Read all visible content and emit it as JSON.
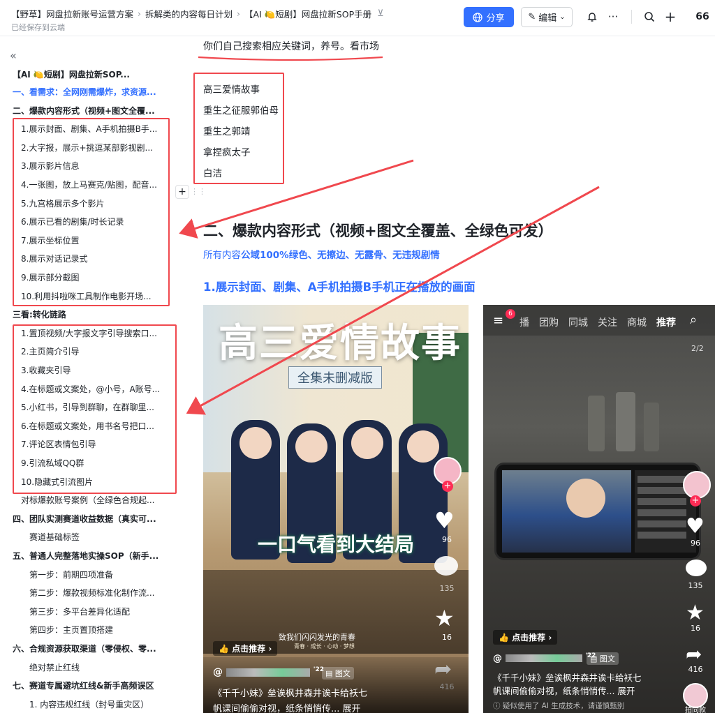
{
  "topbar": {
    "crumbs": [
      "【野草】网盘拉新账号运营方案",
      "拆解类的内容每日计划",
      "【AI 🍋短剧】网盘拉新SOP手册"
    ],
    "saved_status": "已经保存到云端",
    "share_label": "分享",
    "edit_label": "编辑",
    "more_label": "···",
    "quote_label": "66"
  },
  "sidebar": {
    "doc_title": "【AI 🍋短剧】网盘拉新SOP...",
    "items": [
      {
        "label": "一、看需求：全网刚需爆炸，求资源...",
        "kind": "active"
      },
      {
        "label": "二、爆款内容形式（视频+图文全覆...",
        "kind": "h1"
      },
      {
        "label": "1.展示封面、剧集、A手机拍摄B手...",
        "kind": "sub"
      },
      {
        "label": "2.大字报，展示+挑逗某部影视剧...",
        "kind": "sub"
      },
      {
        "label": "3.展示影片信息",
        "kind": "sub"
      },
      {
        "label": "4.一张图，放上马赛克/贴图，配音...",
        "kind": "sub"
      },
      {
        "label": "5.九宫格展示多个影片",
        "kind": "sub"
      },
      {
        "label": "6.展示已看的剧集/时长记录",
        "kind": "sub"
      },
      {
        "label": "7.展示坐标位置",
        "kind": "sub"
      },
      {
        "label": "8.展示对话记录式",
        "kind": "sub"
      },
      {
        "label": "9.展示部分截图",
        "kind": "sub"
      },
      {
        "label": "10.利用抖啦咪工具制作电影开场...",
        "kind": "sub"
      },
      {
        "label": "三看:转化链路",
        "kind": "h1"
      },
      {
        "label": "1.置顶视频/大字报文字引导搜索口...",
        "kind": "sub"
      },
      {
        "label": "2.主页简介引导",
        "kind": "sub"
      },
      {
        "label": "3.收藏夹引导",
        "kind": "sub"
      },
      {
        "label": "4.在标题或文案处，@小号，A账号...",
        "kind": "sub"
      },
      {
        "label": "5.小红书，引导到群聊，在群聊里...",
        "kind": "sub"
      },
      {
        "label": "6.在标题或文案处，用书名号把口...",
        "kind": "sub"
      },
      {
        "label": "7.评论区表情包引导",
        "kind": "sub"
      },
      {
        "label": "9.引流私域QQ群",
        "kind": "sub"
      },
      {
        "label": "10.隐藏式引流图片",
        "kind": "sub"
      },
      {
        "label": "对标爆款账号案例（全绿色合规起...",
        "kind": "sub2"
      },
      {
        "label": "四、团队实测赛道收益数据（真实可...",
        "kind": "h1"
      },
      {
        "label": "赛道基础标签",
        "kind": "sub3"
      },
      {
        "label": "五、普通人完整落地实操SOP（新手...",
        "kind": "h1"
      },
      {
        "label": "第一步：前期四项准备",
        "kind": "sub3"
      },
      {
        "label": "第二步：爆款视频标准化制作流...",
        "kind": "sub3"
      },
      {
        "label": "第三步：多平台差异化适配",
        "kind": "sub3"
      },
      {
        "label": "第四步：主页置顶搭建",
        "kind": "sub3"
      },
      {
        "label": "六、合规资源获取渠道（零侵权、零...",
        "kind": "h1"
      },
      {
        "label": "绝对禁止红线",
        "kind": "sub3"
      },
      {
        "label": "七、赛道专属避坑红线&新手高频误区",
        "kind": "h1"
      },
      {
        "label": "1. 内容违规红线（封号重灾区）",
        "kind": "sub3"
      }
    ]
  },
  "content": {
    "intro_line": "你们自己搜索相应关键词，养号。看市场",
    "keywords": [
      "高三爱情故事",
      "重生之征服郭伯母",
      "重生之郭靖",
      "拿捏疯太子",
      "白洁"
    ],
    "section_heading": "二、爆款内容形式（视频+图文全覆盖、全绿色可发）",
    "note_prefix": "所有内容",
    "note_bold": "公域100%绿色、无擦边、无露骨、无违规剧情",
    "sub_heading": "1.展示封面、剧集、A手机拍摄B手机正在播放的画面"
  },
  "left_image": {
    "poster_title": "高三爱情故事",
    "poster_badge": "全集未删减版",
    "poster_slogan": "一口气看到大结局",
    "poster_footer": "致我们闪闪发光的青春",
    "poster_footer2": "青春 · 成长 · 心动 · 梦想",
    "recommend": "点击推荐",
    "like_count": "96",
    "comment_count": "135",
    "star_count": "16",
    "share_count": "416",
    "account": "@",
    "account_suffix": "'22",
    "tag": "图文",
    "caption1": "《千千小妹》垒诶枫井森井诶卡给袄七",
    "caption2": "帆课间偷偷对视，纸条悄悄传...  展开"
  },
  "right_image": {
    "nav_items": [
      "播",
      "团购",
      "同城",
      "关注",
      "商城",
      "推荐"
    ],
    "badge": "6",
    "page_indicator": "2/2",
    "recommend": "点击推荐",
    "like_count": "96",
    "comment_count": "135",
    "star_count": "16",
    "share_count": "416",
    "account": "@",
    "account_suffix": "'22",
    "tag": "图文",
    "caption1": "《千千小妹》垒诶枫井森井诶卡给袄七",
    "caption2": "帆课间偷偷对视，纸条悄悄传...  展开",
    "ai_notice": "疑似使用了 AI 生成技术，请谨慎甄别",
    "shoot_same": "拍同款"
  },
  "colors": {
    "accent": "#3370ff",
    "annotation_red": "#f0484e"
  }
}
